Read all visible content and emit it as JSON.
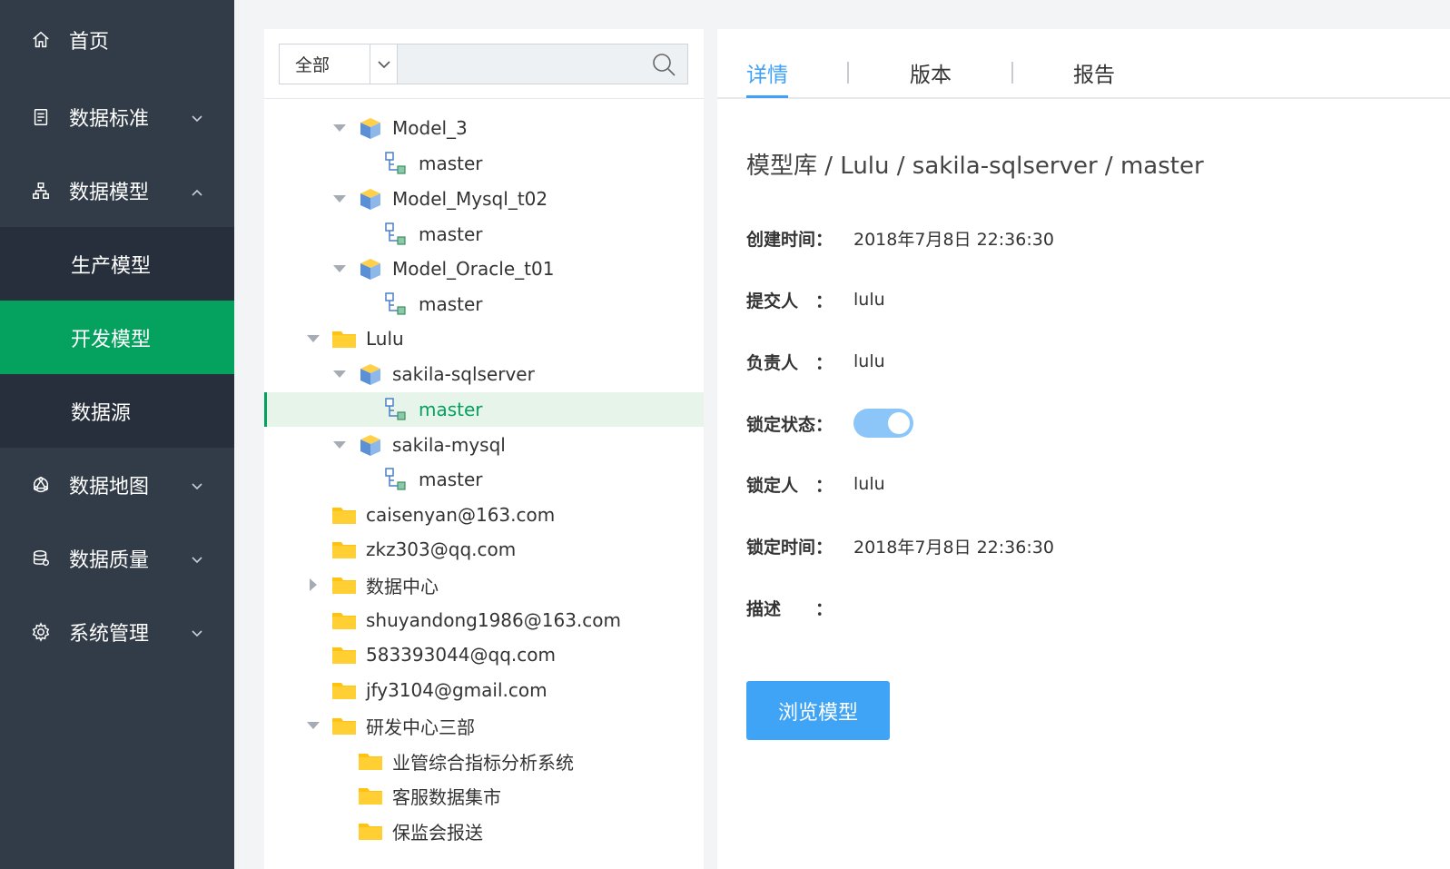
{
  "sidebar": {
    "home": "首页",
    "data_standard": "数据标准",
    "data_model": "数据模型",
    "prod_model": "生产模型",
    "dev_model": "开发模型",
    "data_source": "数据源",
    "data_map": "数据地图",
    "data_quality": "数据质量",
    "sys_admin": "系统管理"
  },
  "search": {
    "scope": "全部",
    "placeholder": ""
  },
  "tree": {
    "model_3": "Model_3",
    "model_3_master": "master",
    "model_mysql_t02": "Model_Mysql_t02",
    "model_mysql_t02_master": "master",
    "model_oracle_t01": "Model_Oracle_t01",
    "model_oracle_t01_master": "master",
    "lulu": "Lulu",
    "sakila_sqlserver": "sakila-sqlserver",
    "sakila_sqlserver_master": "master",
    "sakila_mysql": "sakila-mysql",
    "sakila_mysql_master": "master",
    "caisenyan": "caisenyan@163.com",
    "zkz303": "zkz303@qq.com",
    "data_center": "数据中心",
    "shuyandong": "shuyandong1986@163.com",
    "qq583393044": "583393044@qq.com",
    "jfy3104": "jfy3104@gmail.com",
    "rd_center_3": "研发中心三部",
    "biz_analysis": "业管综合指标分析系统",
    "cs_datamart": "客服数据集市",
    "cbirc_report": "保监会报送"
  },
  "detail": {
    "tabs": [
      "详情",
      "版本",
      "报告"
    ],
    "breadcrumb": "模型库 / Lulu / sakila-sqlserver / master",
    "fields": {
      "created_label": "创建时间：",
      "created_value": "2018年7月8日 22:36:30",
      "submitter_label": "提交人　：",
      "submitter_value": "lulu",
      "owner_label": "负责人　：",
      "owner_value": "lulu",
      "lock_status_label": "锁定状态：",
      "lock_status_on": true,
      "locker_label": "锁定人　：",
      "locker_value": "lulu",
      "lock_time_label": "锁定时间：",
      "lock_time_value": "2018年7月8日 22:36:30",
      "desc_label": "描述　　：",
      "desc_value": ""
    },
    "browse_button": "浏览模型"
  },
  "colors": {
    "sidebar_bg": "#323c48",
    "submenu_bg": "#262f3b",
    "active_green": "#05a15f",
    "accent_blue": "#3fa2f7"
  }
}
